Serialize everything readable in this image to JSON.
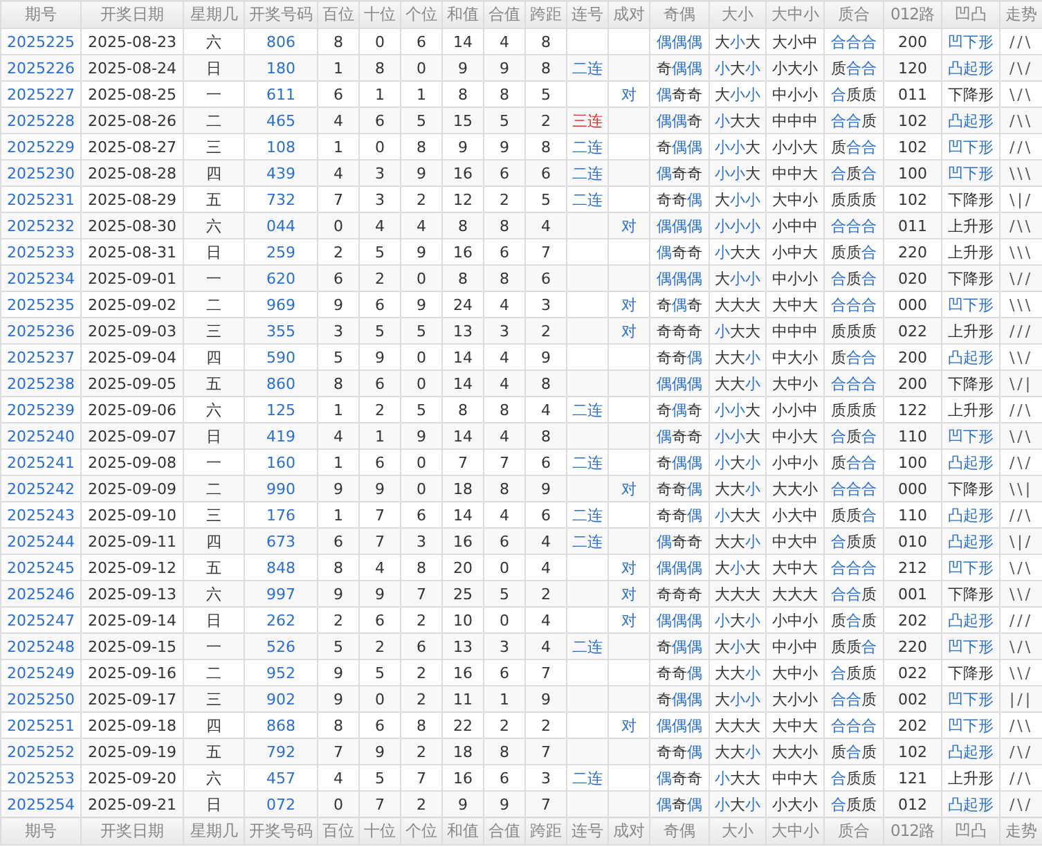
{
  "header": [
    "期号",
    "开奖日期",
    "星期几",
    "开奖号码",
    "百位",
    "十位",
    "个位",
    "和值",
    "合值",
    "跨距",
    "连号",
    "成对",
    "奇偶",
    "大小",
    "大中小",
    "质合",
    "012路",
    "凹凸",
    "走势"
  ],
  "rows": [
    {
      "issue": "2025225",
      "date": "2025-08-23",
      "weekday": "六",
      "number": "806",
      "hundreds": "8",
      "tens": "0",
      "ones": "6",
      "sum": "14",
      "sum_tail": "4",
      "span": "8",
      "parity": {
        "text": "偶偶偶",
        "hl": [
          true,
          true,
          true
        ]
      },
      "size": {
        "text": "大小大",
        "hl": [
          false,
          true,
          false
        ]
      },
      "range": "大小中",
      "prime": {
        "text": "合合合",
        "hl": [
          true,
          true,
          true
        ]
      },
      "route": "200",
      "shape": {
        "text": "凹下形",
        "link": true
      },
      "trend": "//\\"
    },
    {
      "issue": "2025226",
      "date": "2025-08-24",
      "weekday": "日",
      "number": "180",
      "hundreds": "1",
      "tens": "8",
      "ones": "0",
      "sum": "9",
      "sum_tail": "9",
      "span": "8",
      "consecutive": {
        "text": "二连",
        "color": "#2a6fd0"
      },
      "parity": {
        "text": "奇偶偶",
        "hl": [
          false,
          true,
          true
        ]
      },
      "size": {
        "text": "小大小",
        "hl": [
          true,
          false,
          true
        ]
      },
      "range": "小大小",
      "prime": {
        "text": "质合合",
        "hl": [
          false,
          true,
          true
        ]
      },
      "route": "120",
      "shape": {
        "text": "凸起形",
        "link": true
      },
      "trend": "/\\/"
    },
    {
      "issue": "2025227",
      "date": "2025-08-25",
      "weekday": "一",
      "number": "611",
      "hundreds": "6",
      "tens": "1",
      "ones": "1",
      "sum": "8",
      "sum_tail": "8",
      "span": "5",
      "pair": "对",
      "parity": {
        "text": "偶奇奇",
        "hl": [
          true,
          false,
          false
        ]
      },
      "size": {
        "text": "大小小",
        "hl": [
          false,
          true,
          true
        ]
      },
      "range": "中小小",
      "prime": {
        "text": "合质质",
        "hl": [
          true,
          false,
          false
        ]
      },
      "route": "011",
      "shape": {
        "text": "下降形",
        "link": false
      },
      "trend": "\\/\\"
    },
    {
      "issue": "2025228",
      "date": "2025-08-26",
      "weekday": "二",
      "number": "465",
      "hundreds": "4",
      "tens": "6",
      "ones": "5",
      "sum": "15",
      "sum_tail": "5",
      "span": "2",
      "consecutive": {
        "text": "三连",
        "color": "#e0302c"
      },
      "parity": {
        "text": "偶偶奇",
        "hl": [
          true,
          true,
          false
        ]
      },
      "size": {
        "text": "小大大",
        "hl": [
          true,
          false,
          false
        ]
      },
      "range": "中中中",
      "prime": {
        "text": "合合质",
        "hl": [
          true,
          true,
          false
        ]
      },
      "route": "102",
      "shape": {
        "text": "凸起形",
        "link": true
      },
      "trend": "/\\\\"
    },
    {
      "issue": "2025229",
      "date": "2025-08-27",
      "weekday": "三",
      "number": "108",
      "hundreds": "1",
      "tens": "0",
      "ones": "8",
      "sum": "9",
      "sum_tail": "9",
      "span": "8",
      "consecutive": {
        "text": "二连",
        "color": "#2a6fd0"
      },
      "parity": {
        "text": "奇偶偶",
        "hl": [
          false,
          true,
          true
        ]
      },
      "size": {
        "text": "小小大",
        "hl": [
          true,
          true,
          false
        ]
      },
      "range": "小小大",
      "prime": {
        "text": "质合合",
        "hl": [
          false,
          true,
          true
        ]
      },
      "route": "102",
      "shape": {
        "text": "凹下形",
        "link": true
      },
      "trend": "//\\"
    },
    {
      "issue": "2025230",
      "date": "2025-08-28",
      "weekday": "四",
      "number": "439",
      "hundreds": "4",
      "tens": "3",
      "ones": "9",
      "sum": "16",
      "sum_tail": "6",
      "span": "6",
      "consecutive": {
        "text": "二连",
        "color": "#2a6fd0"
      },
      "parity": {
        "text": "偶奇奇",
        "hl": [
          true,
          false,
          false
        ]
      },
      "size": {
        "text": "小小大",
        "hl": [
          true,
          true,
          false
        ]
      },
      "range": "中中大",
      "prime": {
        "text": "合质合",
        "hl": [
          true,
          false,
          true
        ]
      },
      "route": "100",
      "shape": {
        "text": "凹下形",
        "link": true
      },
      "trend": "\\\\\\"
    },
    {
      "issue": "2025231",
      "date": "2025-08-29",
      "weekday": "五",
      "number": "732",
      "hundreds": "7",
      "tens": "3",
      "ones": "2",
      "sum": "12",
      "sum_tail": "2",
      "span": "5",
      "consecutive": {
        "text": "二连",
        "color": "#2a6fd0"
      },
      "parity": {
        "text": "奇奇偶",
        "hl": [
          false,
          false,
          true
        ]
      },
      "size": {
        "text": "大小小",
        "hl": [
          false,
          true,
          true
        ]
      },
      "range": "大中小",
      "prime": {
        "text": "质质质",
        "hl": [
          false,
          false,
          false
        ]
      },
      "route": "102",
      "shape": {
        "text": "下降形",
        "link": false
      },
      "trend": "\\|/"
    },
    {
      "issue": "2025232",
      "date": "2025-08-30",
      "weekday": "六",
      "number": "044",
      "hundreds": "0",
      "tens": "4",
      "ones": "4",
      "sum": "8",
      "sum_tail": "8",
      "span": "4",
      "pair": "对",
      "parity": {
        "text": "偶偶偶",
        "hl": [
          true,
          true,
          true
        ]
      },
      "size": {
        "text": "小小小",
        "hl": [
          true,
          true,
          true
        ]
      },
      "range": "小中中",
      "prime": {
        "text": "合合合",
        "hl": [
          true,
          true,
          true
        ]
      },
      "route": "011",
      "shape": {
        "text": "上升形",
        "link": false
      },
      "trend": "/\\\\"
    },
    {
      "issue": "2025233",
      "date": "2025-08-31",
      "weekday": "日",
      "number": "259",
      "hundreds": "2",
      "tens": "5",
      "ones": "9",
      "sum": "16",
      "sum_tail": "6",
      "span": "7",
      "parity": {
        "text": "偶奇奇",
        "hl": [
          true,
          false,
          false
        ]
      },
      "size": {
        "text": "小大大",
        "hl": [
          true,
          false,
          false
        ]
      },
      "range": "小中大",
      "prime": {
        "text": "质质合",
        "hl": [
          false,
          false,
          true
        ]
      },
      "route": "220",
      "shape": {
        "text": "上升形",
        "link": false
      },
      "trend": "\\\\\\"
    },
    {
      "issue": "2025234",
      "date": "2025-09-01",
      "weekday": "一",
      "number": "620",
      "hundreds": "6",
      "tens": "2",
      "ones": "0",
      "sum": "8",
      "sum_tail": "8",
      "span": "6",
      "parity": {
        "text": "偶偶偶",
        "hl": [
          true,
          true,
          true
        ]
      },
      "size": {
        "text": "大小小",
        "hl": [
          false,
          true,
          true
        ]
      },
      "range": "中小小",
      "prime": {
        "text": "合质合",
        "hl": [
          true,
          false,
          true
        ]
      },
      "route": "020",
      "shape": {
        "text": "下降形",
        "link": false
      },
      "trend": "\\//"
    },
    {
      "issue": "2025235",
      "date": "2025-09-02",
      "weekday": "二",
      "number": "969",
      "hundreds": "9",
      "tens": "6",
      "ones": "9",
      "sum": "24",
      "sum_tail": "4",
      "span": "3",
      "pair": "对",
      "parity": {
        "text": "奇偶奇",
        "hl": [
          false,
          true,
          false
        ]
      },
      "size": {
        "text": "大大大",
        "hl": [
          false,
          false,
          false
        ]
      },
      "range": "大中大",
      "prime": {
        "text": "合合合",
        "hl": [
          true,
          true,
          true
        ]
      },
      "route": "000",
      "shape": {
        "text": "凹下形",
        "link": true
      },
      "trend": "\\\\\\"
    },
    {
      "issue": "2025236",
      "date": "2025-09-03",
      "weekday": "三",
      "number": "355",
      "hundreds": "3",
      "tens": "5",
      "ones": "5",
      "sum": "13",
      "sum_tail": "3",
      "span": "2",
      "pair": "对",
      "parity": {
        "text": "奇奇奇",
        "hl": [
          false,
          false,
          false
        ]
      },
      "size": {
        "text": "小大大",
        "hl": [
          true,
          false,
          false
        ]
      },
      "range": "中中中",
      "prime": {
        "text": "质质质",
        "hl": [
          false,
          false,
          false
        ]
      },
      "route": "022",
      "shape": {
        "text": "上升形",
        "link": false
      },
      "trend": "///"
    },
    {
      "issue": "2025237",
      "date": "2025-09-04",
      "weekday": "四",
      "number": "590",
      "hundreds": "5",
      "tens": "9",
      "ones": "0",
      "sum": "14",
      "sum_tail": "4",
      "span": "9",
      "parity": {
        "text": "奇奇偶",
        "hl": [
          false,
          false,
          true
        ]
      },
      "size": {
        "text": "大大小",
        "hl": [
          false,
          false,
          true
        ]
      },
      "range": "中大小",
      "prime": {
        "text": "质合合",
        "hl": [
          false,
          true,
          true
        ]
      },
      "route": "200",
      "shape": {
        "text": "凸起形",
        "link": true
      },
      "trend": "\\\\/"
    },
    {
      "issue": "2025238",
      "date": "2025-09-05",
      "weekday": "五",
      "number": "860",
      "hundreds": "8",
      "tens": "6",
      "ones": "0",
      "sum": "14",
      "sum_tail": "4",
      "span": "8",
      "parity": {
        "text": "偶偶偶",
        "hl": [
          true,
          true,
          true
        ]
      },
      "size": {
        "text": "大大小",
        "hl": [
          false,
          false,
          true
        ]
      },
      "range": "大中小",
      "prime": {
        "text": "合合合",
        "hl": [
          true,
          true,
          true
        ]
      },
      "route": "200",
      "shape": {
        "text": "下降形",
        "link": false
      },
      "trend": "\\/|"
    },
    {
      "issue": "2025239",
      "date": "2025-09-06",
      "weekday": "六",
      "number": "125",
      "hundreds": "1",
      "tens": "2",
      "ones": "5",
      "sum": "8",
      "sum_tail": "8",
      "span": "4",
      "consecutive": {
        "text": "二连",
        "color": "#2a6fd0"
      },
      "parity": {
        "text": "奇偶奇",
        "hl": [
          false,
          true,
          false
        ]
      },
      "size": {
        "text": "小小大",
        "hl": [
          true,
          true,
          false
        ]
      },
      "range": "小小中",
      "prime": {
        "text": "质质质",
        "hl": [
          false,
          false,
          false
        ]
      },
      "route": "122",
      "shape": {
        "text": "上升形",
        "link": false
      },
      "trend": "//\\"
    },
    {
      "issue": "2025240",
      "date": "2025-09-07",
      "weekday": "日",
      "number": "419",
      "hundreds": "4",
      "tens": "1",
      "ones": "9",
      "sum": "14",
      "sum_tail": "4",
      "span": "8",
      "parity": {
        "text": "偶奇奇",
        "hl": [
          true,
          false,
          false
        ]
      },
      "size": {
        "text": "小小大",
        "hl": [
          true,
          true,
          false
        ]
      },
      "range": "中小大",
      "prime": {
        "text": "合质合",
        "hl": [
          true,
          false,
          true
        ]
      },
      "route": "110",
      "shape": {
        "text": "凹下形",
        "link": true
      },
      "trend": "\\/\\"
    },
    {
      "issue": "2025241",
      "date": "2025-09-08",
      "weekday": "一",
      "number": "160",
      "hundreds": "1",
      "tens": "6",
      "ones": "0",
      "sum": "7",
      "sum_tail": "7",
      "span": "6",
      "consecutive": {
        "text": "二连",
        "color": "#2a6fd0"
      },
      "parity": {
        "text": "奇偶偶",
        "hl": [
          false,
          true,
          true
        ]
      },
      "size": {
        "text": "小大小",
        "hl": [
          true,
          false,
          true
        ]
      },
      "range": "小中小",
      "prime": {
        "text": "质合合",
        "hl": [
          false,
          true,
          true
        ]
      },
      "route": "100",
      "shape": {
        "text": "凸起形",
        "link": true
      },
      "trend": "/\\/"
    },
    {
      "issue": "2025242",
      "date": "2025-09-09",
      "weekday": "二",
      "number": "990",
      "hundreds": "9",
      "tens": "9",
      "ones": "0",
      "sum": "18",
      "sum_tail": "8",
      "span": "9",
      "pair": "对",
      "parity": {
        "text": "奇奇偶",
        "hl": [
          false,
          false,
          true
        ]
      },
      "size": {
        "text": "大大小",
        "hl": [
          false,
          false,
          true
        ]
      },
      "range": "大大小",
      "prime": {
        "text": "合合合",
        "hl": [
          true,
          true,
          true
        ]
      },
      "route": "000",
      "shape": {
        "text": "下降形",
        "link": false
      },
      "trend": "\\\\|"
    },
    {
      "issue": "2025243",
      "date": "2025-09-10",
      "weekday": "三",
      "number": "176",
      "hundreds": "1",
      "tens": "7",
      "ones": "6",
      "sum": "14",
      "sum_tail": "4",
      "span": "6",
      "consecutive": {
        "text": "二连",
        "color": "#2a6fd0"
      },
      "parity": {
        "text": "奇奇偶",
        "hl": [
          false,
          false,
          true
        ]
      },
      "size": {
        "text": "小大大",
        "hl": [
          true,
          false,
          false
        ]
      },
      "range": "小大中",
      "prime": {
        "text": "质质合",
        "hl": [
          false,
          false,
          true
        ]
      },
      "route": "110",
      "shape": {
        "text": "凸起形",
        "link": true
      },
      "trend": "//\\"
    },
    {
      "issue": "2025244",
      "date": "2025-09-11",
      "weekday": "四",
      "number": "673",
      "hundreds": "6",
      "tens": "7",
      "ones": "3",
      "sum": "16",
      "sum_tail": "6",
      "span": "4",
      "consecutive": {
        "text": "二连",
        "color": "#2a6fd0"
      },
      "parity": {
        "text": "偶奇奇",
        "hl": [
          true,
          false,
          false
        ]
      },
      "size": {
        "text": "大大小",
        "hl": [
          false,
          false,
          true
        ]
      },
      "range": "中大中",
      "prime": {
        "text": "合质质",
        "hl": [
          true,
          false,
          false
        ]
      },
      "route": "010",
      "shape": {
        "text": "凸起形",
        "link": true
      },
      "trend": "\\|/"
    },
    {
      "issue": "2025245",
      "date": "2025-09-12",
      "weekday": "五",
      "number": "848",
      "hundreds": "8",
      "tens": "4",
      "ones": "8",
      "sum": "20",
      "sum_tail": "0",
      "span": "4",
      "pair": "对",
      "parity": {
        "text": "偶偶偶",
        "hl": [
          true,
          true,
          true
        ]
      },
      "size": {
        "text": "大小大",
        "hl": [
          false,
          true,
          false
        ]
      },
      "range": "大中大",
      "prime": {
        "text": "合合合",
        "hl": [
          true,
          true,
          true
        ]
      },
      "route": "212",
      "shape": {
        "text": "凹下形",
        "link": true
      },
      "trend": "\\/\\"
    },
    {
      "issue": "2025246",
      "date": "2025-09-13",
      "weekday": "六",
      "number": "997",
      "hundreds": "9",
      "tens": "9",
      "ones": "7",
      "sum": "25",
      "sum_tail": "5",
      "span": "2",
      "pair": "对",
      "parity": {
        "text": "奇奇奇",
        "hl": [
          false,
          false,
          false
        ]
      },
      "size": {
        "text": "大大大",
        "hl": [
          false,
          false,
          false
        ]
      },
      "range": "大大大",
      "prime": {
        "text": "合合质",
        "hl": [
          true,
          true,
          false
        ]
      },
      "route": "001",
      "shape": {
        "text": "下降形",
        "link": false
      },
      "trend": "\\\\/"
    },
    {
      "issue": "2025247",
      "date": "2025-09-14",
      "weekday": "日",
      "number": "262",
      "hundreds": "2",
      "tens": "6",
      "ones": "2",
      "sum": "10",
      "sum_tail": "0",
      "span": "4",
      "pair": "对",
      "parity": {
        "text": "偶偶偶",
        "hl": [
          true,
          true,
          true
        ]
      },
      "size": {
        "text": "小大小",
        "hl": [
          true,
          false,
          true
        ]
      },
      "range": "小中小",
      "prime": {
        "text": "质合质",
        "hl": [
          false,
          true,
          false
        ]
      },
      "route": "202",
      "shape": {
        "text": "凸起形",
        "link": true
      },
      "trend": "///"
    },
    {
      "issue": "2025248",
      "date": "2025-09-15",
      "weekday": "一",
      "number": "526",
      "hundreds": "5",
      "tens": "2",
      "ones": "6",
      "sum": "13",
      "sum_tail": "3",
      "span": "4",
      "consecutive": {
        "text": "二连",
        "color": "#2a6fd0"
      },
      "parity": {
        "text": "奇偶偶",
        "hl": [
          false,
          true,
          true
        ]
      },
      "size": {
        "text": "大小大",
        "hl": [
          false,
          true,
          false
        ]
      },
      "range": "中小中",
      "prime": {
        "text": "质质合",
        "hl": [
          false,
          false,
          true
        ]
      },
      "route": "220",
      "shape": {
        "text": "凹下形",
        "link": true
      },
      "trend": "\\/\\"
    },
    {
      "issue": "2025249",
      "date": "2025-09-16",
      "weekday": "二",
      "number": "952",
      "hundreds": "9",
      "tens": "5",
      "ones": "2",
      "sum": "16",
      "sum_tail": "6",
      "span": "7",
      "parity": {
        "text": "奇奇偶",
        "hl": [
          false,
          false,
          true
        ]
      },
      "size": {
        "text": "大大小",
        "hl": [
          false,
          false,
          true
        ]
      },
      "range": "大中小",
      "prime": {
        "text": "合质质",
        "hl": [
          true,
          false,
          false
        ]
      },
      "route": "022",
      "shape": {
        "text": "下降形",
        "link": false
      },
      "trend": "\\\\/"
    },
    {
      "issue": "2025250",
      "date": "2025-09-17",
      "weekday": "三",
      "number": "902",
      "hundreds": "9",
      "tens": "0",
      "ones": "2",
      "sum": "11",
      "sum_tail": "1",
      "span": "9",
      "parity": {
        "text": "奇偶偶",
        "hl": [
          false,
          true,
          true
        ]
      },
      "size": {
        "text": "大小小",
        "hl": [
          false,
          true,
          true
        ]
      },
      "range": "大小小",
      "prime": {
        "text": "合合质",
        "hl": [
          true,
          true,
          false
        ]
      },
      "route": "002",
      "shape": {
        "text": "凹下形",
        "link": true
      },
      "trend": "|/|"
    },
    {
      "issue": "2025251",
      "date": "2025-09-18",
      "weekday": "四",
      "number": "868",
      "hundreds": "8",
      "tens": "6",
      "ones": "8",
      "sum": "22",
      "sum_tail": "2",
      "span": "2",
      "pair": "对",
      "parity": {
        "text": "偶偶偶",
        "hl": [
          true,
          true,
          true
        ]
      },
      "size": {
        "text": "大大大",
        "hl": [
          false,
          false,
          false
        ]
      },
      "range": "大中大",
      "prime": {
        "text": "合合合",
        "hl": [
          true,
          true,
          true
        ]
      },
      "route": "202",
      "shape": {
        "text": "凹下形",
        "link": true
      },
      "trend": "/\\\\"
    },
    {
      "issue": "2025252",
      "date": "2025-09-19",
      "weekday": "五",
      "number": "792",
      "hundreds": "7",
      "tens": "9",
      "ones": "2",
      "sum": "18",
      "sum_tail": "8",
      "span": "7",
      "parity": {
        "text": "奇奇偶",
        "hl": [
          false,
          false,
          true
        ]
      },
      "size": {
        "text": "大大小",
        "hl": [
          false,
          false,
          true
        ]
      },
      "range": "大大小",
      "prime": {
        "text": "质合质",
        "hl": [
          false,
          true,
          false
        ]
      },
      "route": "102",
      "shape": {
        "text": "凸起形",
        "link": true
      },
      "trend": "/\\/"
    },
    {
      "issue": "2025253",
      "date": "2025-09-20",
      "weekday": "六",
      "number": "457",
      "hundreds": "4",
      "tens": "5",
      "ones": "7",
      "sum": "16",
      "sum_tail": "6",
      "span": "3",
      "consecutive": {
        "text": "二连",
        "color": "#2a6fd0"
      },
      "parity": {
        "text": "偶奇奇",
        "hl": [
          true,
          false,
          false
        ]
      },
      "size": {
        "text": "小大大",
        "hl": [
          true,
          false,
          false
        ]
      },
      "range": "中中大",
      "prime": {
        "text": "合质质",
        "hl": [
          true,
          false,
          false
        ]
      },
      "route": "121",
      "shape": {
        "text": "上升形",
        "link": false
      },
      "trend": "//\\"
    },
    {
      "issue": "2025254",
      "date": "2025-09-21",
      "weekday": "日",
      "number": "072",
      "hundreds": "0",
      "tens": "7",
      "ones": "2",
      "sum": "9",
      "sum_tail": "9",
      "span": "7",
      "parity": {
        "text": "偶奇偶",
        "hl": [
          true,
          false,
          true
        ]
      },
      "size": {
        "text": "小大小",
        "hl": [
          true,
          false,
          true
        ]
      },
      "range": "小大小",
      "prime": {
        "text": "合质质",
        "hl": [
          true,
          false,
          false
        ]
      },
      "route": "012",
      "shape": {
        "text": "凸起形",
        "link": true
      },
      "trend": "/\\/"
    }
  ],
  "footer": [
    "期号",
    "开奖日期",
    "星期几",
    "开奖号码",
    "百位",
    "十位",
    "个位",
    "和值",
    "合值",
    "跨距",
    "连号",
    "成对",
    "奇偶",
    "大小",
    "大中小",
    "质合",
    "012路",
    "凹凸",
    "走势"
  ]
}
